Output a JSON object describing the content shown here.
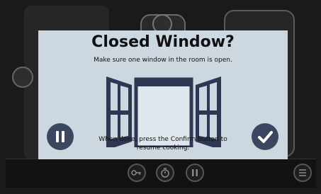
{
  "dialog": {
    "title": "Closed Window?",
    "subtitle": "Make sure one window in the room is open.",
    "message": "When done, press the Confirm button to resume cooking."
  },
  "buttons": {
    "pause_icon": "pause-icon",
    "confirm_icon": "checkmark-icon"
  },
  "bottom_bar": {
    "icons": [
      "key-icon",
      "timer-icon",
      "pause-icon",
      "menu-icon"
    ]
  },
  "colors": {
    "dialog_background": "#cdd7e0",
    "button_background": "#3b4660",
    "window_frame": "#2e3754",
    "screen_background": "#1a1a1a"
  }
}
